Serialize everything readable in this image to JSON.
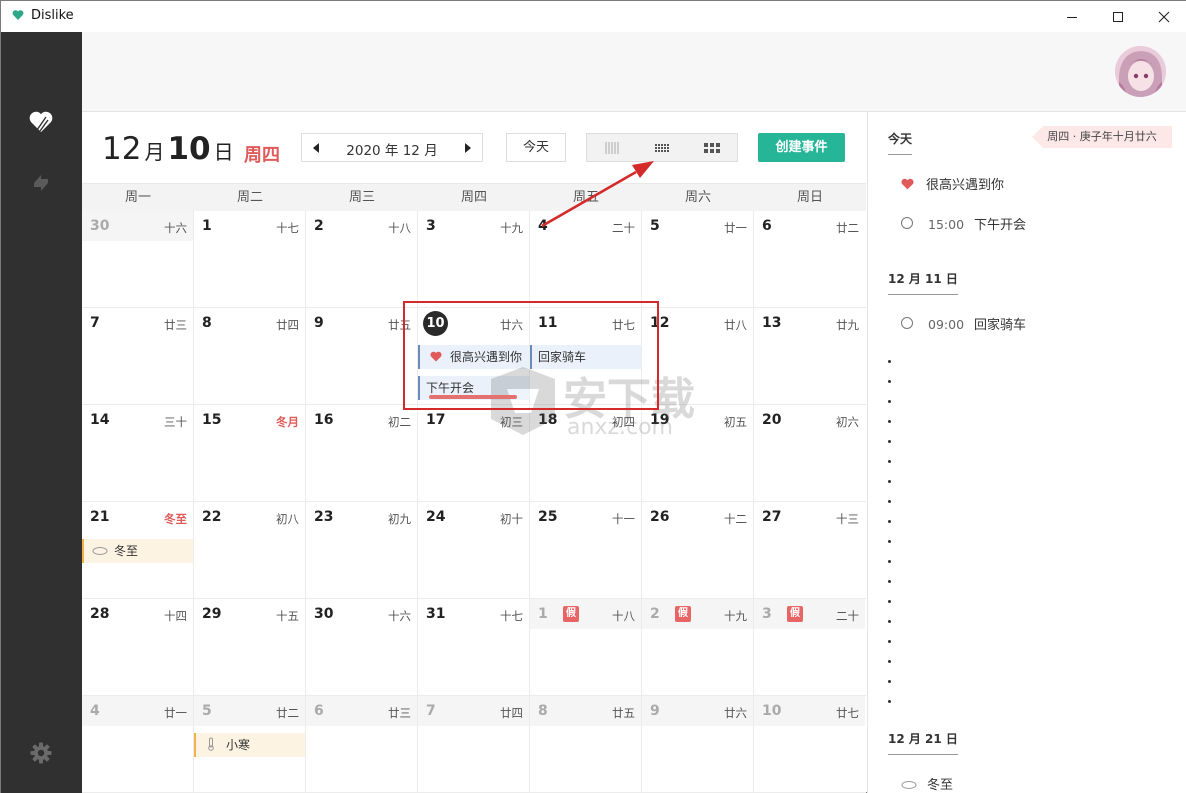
{
  "window": {
    "title": "Dislike"
  },
  "header": {
    "month_num": "12",
    "month_unit": "月",
    "day_num": "10",
    "day_unit": "日",
    "weekday": "周四",
    "month_label": "2020 年 12 月",
    "today_label": "今天",
    "create_label": "创建事件"
  },
  "weekdays": [
    "周一",
    "周二",
    "周三",
    "周四",
    "周五",
    "周六",
    "周日"
  ],
  "weeks": [
    [
      {
        "d": "30",
        "l": "十六",
        "o": true
      },
      {
        "d": "1",
        "l": "十七"
      },
      {
        "d": "2",
        "l": "十八"
      },
      {
        "d": "3",
        "l": "十九"
      },
      {
        "d": "4",
        "l": "二十"
      },
      {
        "d": "5",
        "l": "廿一"
      },
      {
        "d": "6",
        "l": "廿二"
      }
    ],
    [
      {
        "d": "7",
        "l": "廿三"
      },
      {
        "d": "8",
        "l": "廿四"
      },
      {
        "d": "9",
        "l": "廿五"
      },
      {
        "d": "10",
        "l": "廿六",
        "today": true
      },
      {
        "d": "11",
        "l": "廿七"
      },
      {
        "d": "12",
        "l": "廿八"
      },
      {
        "d": "13",
        "l": "廿九"
      }
    ],
    [
      {
        "d": "14",
        "l": "三十"
      },
      {
        "d": "15",
        "l": "冬月",
        "red": true
      },
      {
        "d": "16",
        "l": "初二"
      },
      {
        "d": "17",
        "l": "初三"
      },
      {
        "d": "18",
        "l": "初四"
      },
      {
        "d": "19",
        "l": "初五"
      },
      {
        "d": "20",
        "l": "初六"
      }
    ],
    [
      {
        "d": "21",
        "l": "冬至",
        "red": true
      },
      {
        "d": "22",
        "l": "初八"
      },
      {
        "d": "23",
        "l": "初九"
      },
      {
        "d": "24",
        "l": "初十"
      },
      {
        "d": "25",
        "l": "十一"
      },
      {
        "d": "26",
        "l": "十二"
      },
      {
        "d": "27",
        "l": "十三"
      }
    ],
    [
      {
        "d": "28",
        "l": "十四"
      },
      {
        "d": "29",
        "l": "十五"
      },
      {
        "d": "30",
        "l": "十六"
      },
      {
        "d": "31",
        "l": "十七"
      },
      {
        "d": "1",
        "l": "十八",
        "o": true,
        "hol": "假"
      },
      {
        "d": "2",
        "l": "十九",
        "o": true,
        "hol": "假"
      },
      {
        "d": "3",
        "l": "二十",
        "o": true,
        "hol": "假"
      }
    ],
    [
      {
        "d": "4",
        "l": "廿一",
        "o": true
      },
      {
        "d": "5",
        "l": "廿二",
        "o": true
      },
      {
        "d": "6",
        "l": "廿三",
        "o": true
      },
      {
        "d": "7",
        "l": "廿四",
        "o": true
      },
      {
        "d": "8",
        "l": "廿五",
        "o": true
      },
      {
        "d": "9",
        "l": "廿六",
        "o": true
      },
      {
        "d": "10",
        "l": "廿七",
        "o": true
      }
    ]
  ],
  "events": {
    "meet": "很高兴遇到你",
    "ride": "回家骑车",
    "afternoon": "下午开会",
    "winter": "冬至",
    "xiaohan": "小寒"
  },
  "right_panel": {
    "today_heading": "今天",
    "lunar_ribbon": "周四 · 庚子年十月廿六",
    "today_items": [
      {
        "time": "",
        "title": "很高兴遇到你"
      },
      {
        "time": "15:00",
        "title": "下午开会"
      }
    ],
    "dec11_heading": "12 月 11 日",
    "dec11_items": [
      {
        "time": "09:00",
        "title": "回家骑车"
      }
    ],
    "dec21_heading": "12 月 21 日",
    "dec21_items": [
      {
        "title": "冬至"
      }
    ]
  },
  "watermark": {
    "text": "安下载",
    "sub": "anxz.com"
  },
  "colors": {
    "sidebar": "#303030",
    "accent": "#26b597",
    "today_red": "#e05a5a",
    "annotation_red": "#d42a2a"
  }
}
